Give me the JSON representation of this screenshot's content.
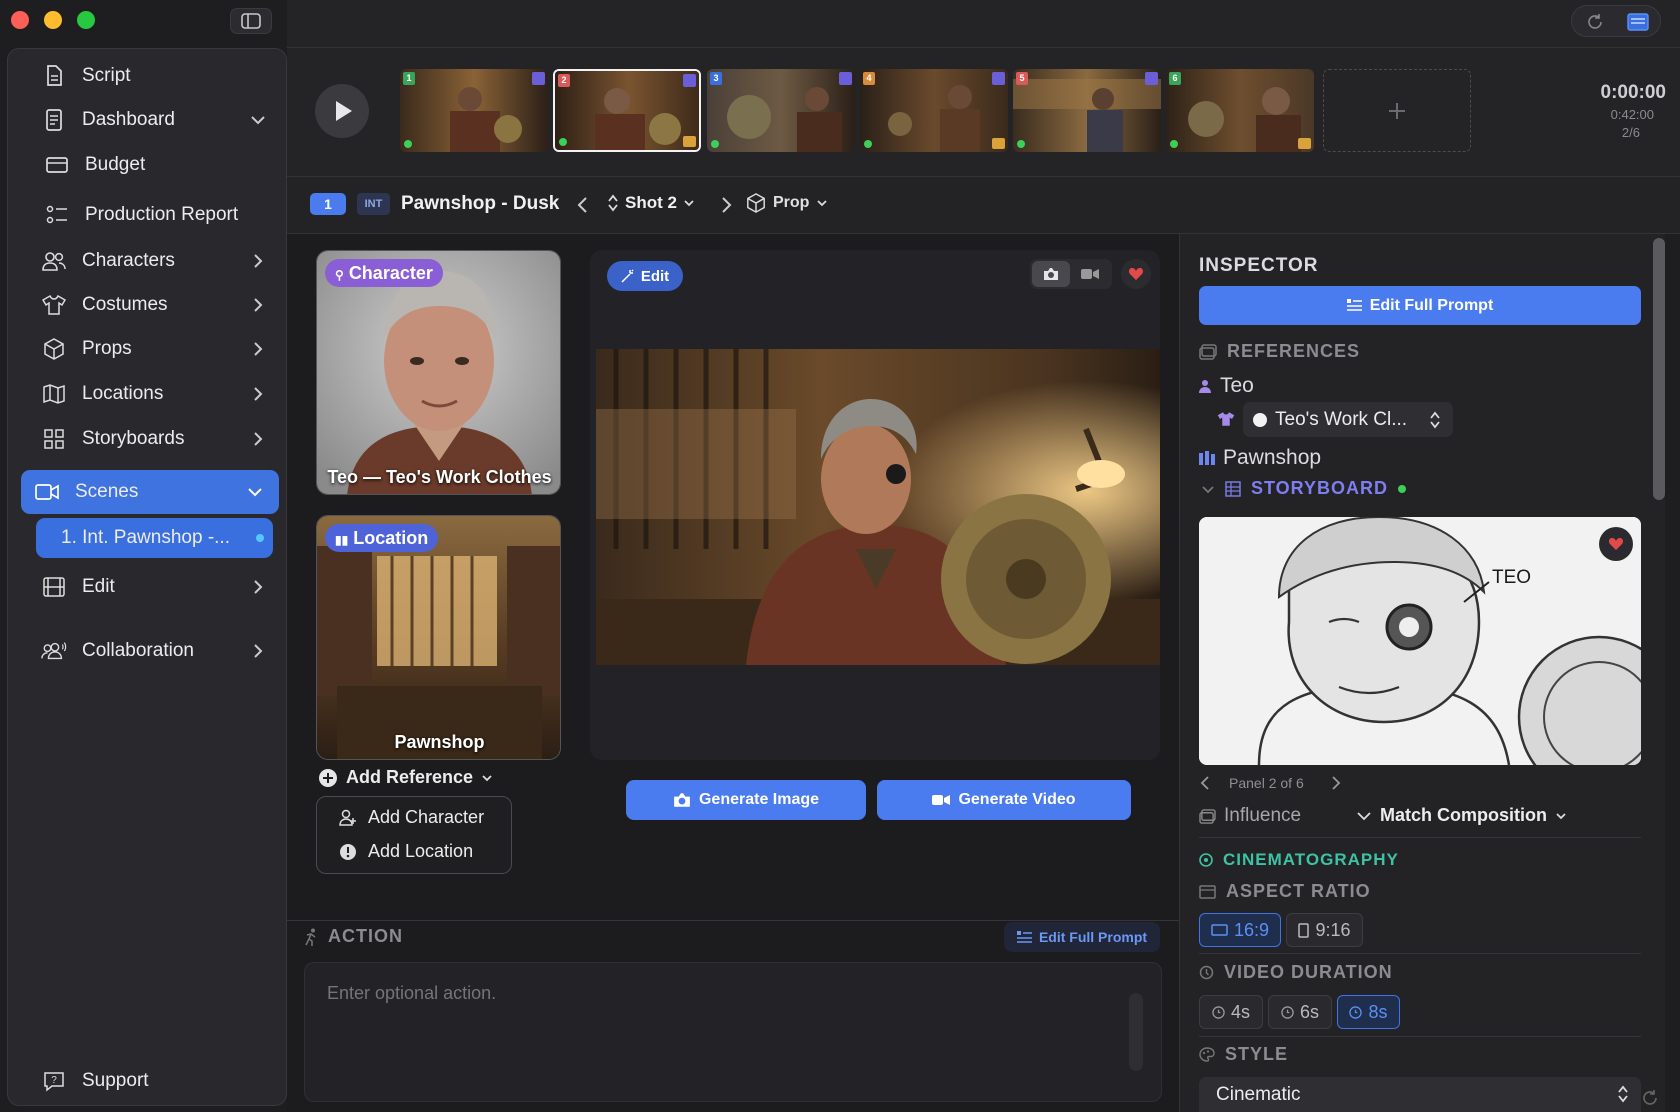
{
  "sidebar": {
    "items": [
      {
        "label": "Script",
        "icon": "script-icon"
      },
      {
        "label": "Dashboard",
        "icon": "dashboard-icon"
      },
      {
        "label": "Budget",
        "icon": "budget-icon"
      },
      {
        "label": "Production Report",
        "icon": "report-icon"
      },
      {
        "label": "Characters",
        "icon": "characters-icon"
      },
      {
        "label": "Costumes",
        "icon": "costume-icon"
      },
      {
        "label": "Props",
        "icon": "props-icon"
      },
      {
        "label": "Locations",
        "icon": "map-icon"
      },
      {
        "label": "Storyboards",
        "icon": "grid-icon"
      },
      {
        "label": "Scenes",
        "icon": "camera-icon"
      },
      {
        "label": "Edit",
        "icon": "film-icon"
      },
      {
        "label": "Collaboration",
        "icon": "people-icon"
      }
    ],
    "active_scene": "1. Int. Pawnshop -...",
    "support": "Support"
  },
  "filmstrip": {
    "shots": [
      "1",
      "2",
      "3",
      "4",
      "5",
      "6"
    ],
    "selected_shot": 2,
    "timecode": "0:00:00",
    "duration": "0:42:00",
    "position": "2/6"
  },
  "scene": {
    "number": "1",
    "int_ext": "INT",
    "title": "Pawnshop - Dusk",
    "shot": "Shot 2",
    "prop": "Prop"
  },
  "references": {
    "character_tag": "Character",
    "character_caption": "Teo — Teo's Work Clothes",
    "location_tag": "Location",
    "location_caption": "Pawnshop",
    "add_reference": "Add Reference",
    "add_character": "Add Character",
    "add_location": "Add Location"
  },
  "preview": {
    "edit_label": "Edit",
    "generate_image": "Generate Image",
    "generate_video": "Generate Video"
  },
  "action": {
    "heading": "ACTION",
    "edit_prompt": "Edit Full Prompt",
    "placeholder": "Enter optional action."
  },
  "inspector": {
    "title": "INSPECTOR",
    "edit_prompt": "Edit Full Prompt",
    "references_heading": "REFERENCES",
    "character_name": "Teo",
    "costume": "Teo's Work Cl...",
    "location_name": "Pawnshop",
    "storyboard_heading": "STORYBOARD",
    "storyboard_label": "TEO",
    "panel": "Panel 2 of 6",
    "influence": "Influence",
    "match": "Match Composition",
    "cinematography": "CINEMATOGRAPHY",
    "aspect_heading": "ASPECT RATIO",
    "aspect_options": [
      "16:9",
      "9:16"
    ],
    "aspect_selected": "16:9",
    "duration_heading": "VIDEO DURATION",
    "duration_options": [
      "4s",
      "6s",
      "8s"
    ],
    "duration_selected": "8s",
    "style_heading": "STYLE",
    "style_value": "Cinematic"
  },
  "colors": {
    "accent": "#4a7cf0",
    "character_tag": "#8a5fd6",
    "location_tag": "#4f63d8",
    "cinematography": "#3ec2a6",
    "storyboard": "#7f7ef0",
    "favorite": "#e24a4a"
  }
}
